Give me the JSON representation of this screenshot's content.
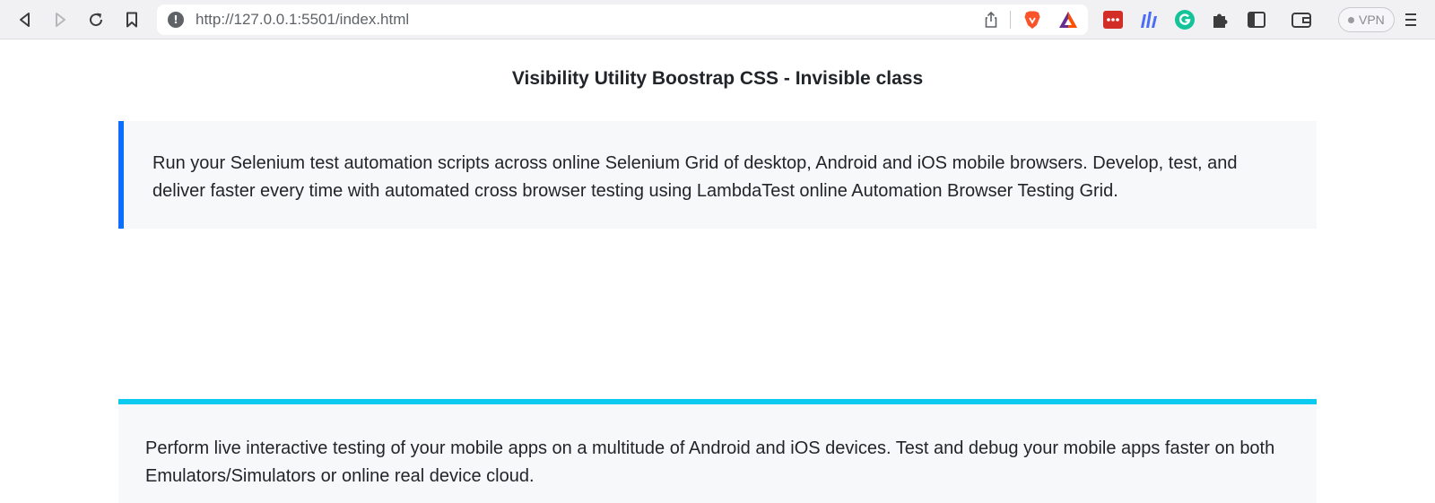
{
  "browser": {
    "url": "http://127.0.0.1:5501/index.html",
    "vpn_label": "VPN"
  },
  "page": {
    "title": "Visibility Utility Boostrap CSS - Invisible class",
    "callouts": [
      {
        "text": "Run your Selenium test automation scripts across online Selenium Grid of desktop, Android and iOS mobile browsers. Develop, test, and deliver faster every time with automated cross browser testing using LambdaTest online Automation Browser Testing Grid.",
        "accent": "#0d6efd"
      },
      {
        "text": "Perform live interactive testing of your mobile apps on a multitude of Android and iOS devices. Test and debug your mobile apps faster on both Emulators/Simulators or online real device cloud.",
        "accent": "#0dcaf0"
      }
    ]
  },
  "icons": {
    "back": "back-icon",
    "forward": "forward-icon",
    "reload": "reload-icon",
    "bookmark": "bookmark-icon",
    "site_info": "info-icon",
    "share": "share-icon",
    "brave_shields": "brave-shields-icon",
    "brave_rewards": "brave-rewards-icon",
    "extensions": [
      "lastpass-icon",
      "metamask-bars-icon",
      "grammarly-icon",
      "puzzle-extensions-icon",
      "sidebar-icon",
      "wallet-icon"
    ],
    "menu": "menu-icon"
  }
}
